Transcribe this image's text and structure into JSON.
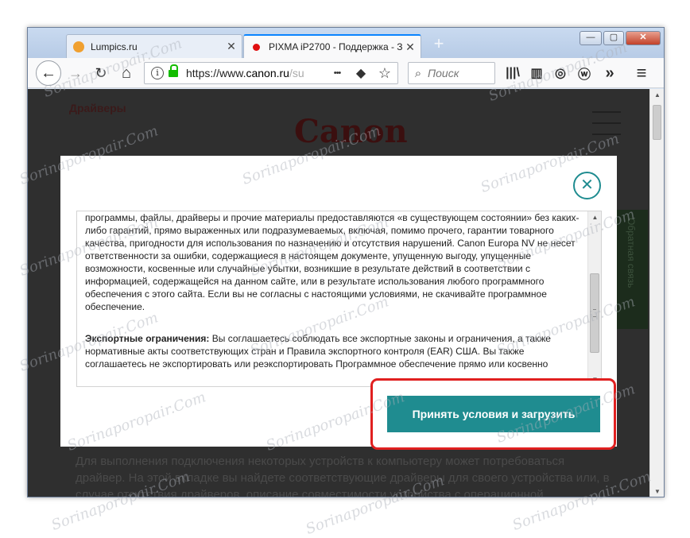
{
  "browser": {
    "tabs": [
      {
        "title": "Lumpics.ru",
        "favicon_color": "#f0a030",
        "active": false
      },
      {
        "title": "PIXMA iP2700 - Поддержка - З",
        "favicon_color": "#e01010",
        "active": true
      }
    ],
    "tab_close_glyph": "✕",
    "new_tab_glyph": "+",
    "window_controls": {
      "minimize": "—",
      "maximize": "▢",
      "close": "✕"
    },
    "nav": {
      "back": "←",
      "forward": "→",
      "reload": "↻",
      "home": "⌂"
    },
    "url": {
      "scheme": "https://www.",
      "host": "canon.ru",
      "path": "/su",
      "info_glyph": "i"
    },
    "url_actions": {
      "more": "•••",
      "pocket": "◆",
      "bookmark": "☆"
    },
    "search": {
      "placeholder": "Поиск",
      "icon": "🔍"
    },
    "toolbar_icons": {
      "library": "|||\\",
      "sidebar": "▥",
      "sync": "◎",
      "account": "ⓦ",
      "overflow": "»",
      "menu": "≡"
    }
  },
  "page": {
    "bg_title": "Драйверы",
    "bg_logo": "Canon",
    "side_label": "Обратная связь",
    "bg_text": "Для выполнения подключения некоторых устройств к компьютеру может потребоваться драйвер. На этой вкладке вы найдете соответствующие драйверы для своего устройства или, в случае отсутствия драйверов, описание совместимости устройства с операционной"
  },
  "modal": {
    "close_glyph": "✕",
    "terms_paragraph_1": "программы, файлы, драйверы и прочие материалы предоставляются «в существующем состоянии» без каких-либо гарантий, прямо выраженных или подразумеваемых, включая, помимо прочего, гарантии товарного качества, пригодности для использования по назначению и отсутствия нарушений. Canon Europa NV не несет ответственности за ошибки, содержащиеся в настоящем документе, упущенную выгоду, упущенные возможности, косвенные или случайные убытки, возникшие в результате действий в соответствии с информацией, содержащейся на данном сайте, или в результате использования любого программного обеспечения с этого сайта. Если вы не согласны с настоящими условиями, не скачивайте программное обеспечение.",
    "export_heading": "Экспортные ограничения:",
    "export_text": " Вы соглашаетесь соблюдать все экспортные законы и ограничения, а также нормативные акты соответствующих стран и Правила экспортного контроля (EAR) США. Вы также соглашаетесь не экспортировать или реэкспортировать Программное обеспечение прямо или косвенно",
    "accept_button": "Принять условия и загрузить",
    "accent_color": "#1f8c90"
  },
  "watermark": "Sorinaporopair.Com"
}
